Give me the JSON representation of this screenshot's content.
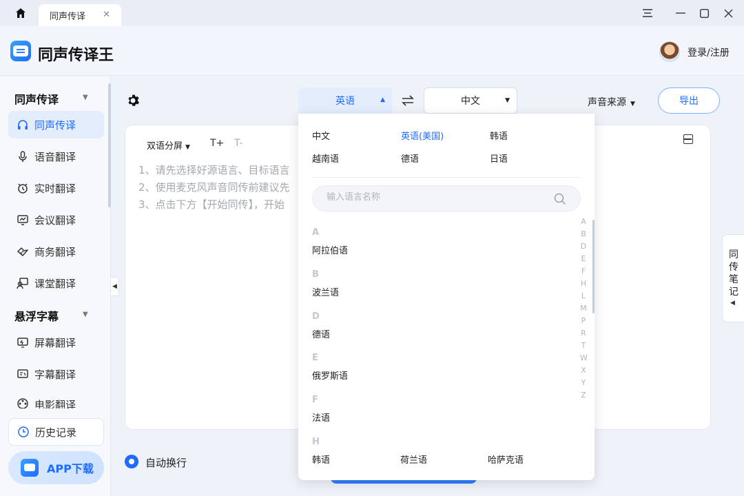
{
  "tabs": [
    {
      "label": "同声传译"
    }
  ],
  "app": {
    "title": "同声传译王",
    "login": "登录/注册"
  },
  "sidebar": {
    "sections": [
      {
        "title": "同声传译",
        "items": [
          "同声传译",
          "语音翻译",
          "实时翻译",
          "会议翻译",
          "商务翻译",
          "课堂翻译"
        ]
      },
      {
        "title": "悬浮字幕",
        "items": [
          "屏幕翻译",
          "字幕翻译",
          "电影翻译"
        ]
      }
    ],
    "history": "历史记录",
    "app_download": "APP下载"
  },
  "toolbar": {
    "source_lang": "英语",
    "target_lang": "中文",
    "voice_source": "声音来源",
    "export": "导出"
  },
  "panel": {
    "split_mode": "双语分屏",
    "font_up": "T+",
    "font_down": "T-",
    "hints": [
      "1、请先选择好源语言、目标语言",
      "2、使用麦克风声音同传前建议先",
      "3、点击下方【开始同传】，开始"
    ]
  },
  "bottom": {
    "auto_wrap": "自动换行"
  },
  "note_tab": {
    "chars": [
      "同",
      "传",
      "笔",
      "记"
    ]
  },
  "dropdown": {
    "recent": [
      "中文",
      "英语(美国)",
      "韩语",
      "越南语",
      "德语",
      "日语"
    ],
    "selected": "英语(美国)",
    "search_placeholder": "输入语言名称",
    "groups": [
      {
        "letter": "A",
        "items": [
          "阿拉伯语"
        ]
      },
      {
        "letter": "B",
        "items": [
          "波兰语"
        ]
      },
      {
        "letter": "D",
        "items": [
          "德语"
        ]
      },
      {
        "letter": "E",
        "items": [
          "俄罗斯语"
        ]
      },
      {
        "letter": "F",
        "items": [
          "法语"
        ]
      },
      {
        "letter": "H",
        "items": [
          "韩语",
          "荷兰语",
          "哈萨克语"
        ]
      }
    ],
    "alphabet": [
      "A",
      "B",
      "D",
      "E",
      "F",
      "H",
      "L",
      "M",
      "P",
      "R",
      "T",
      "W",
      "X",
      "Y",
      "Z"
    ]
  },
  "colors": {
    "accent": "#1f6bff",
    "accent_light": "#e3edfb",
    "hint_text": "#a3a8b0"
  }
}
